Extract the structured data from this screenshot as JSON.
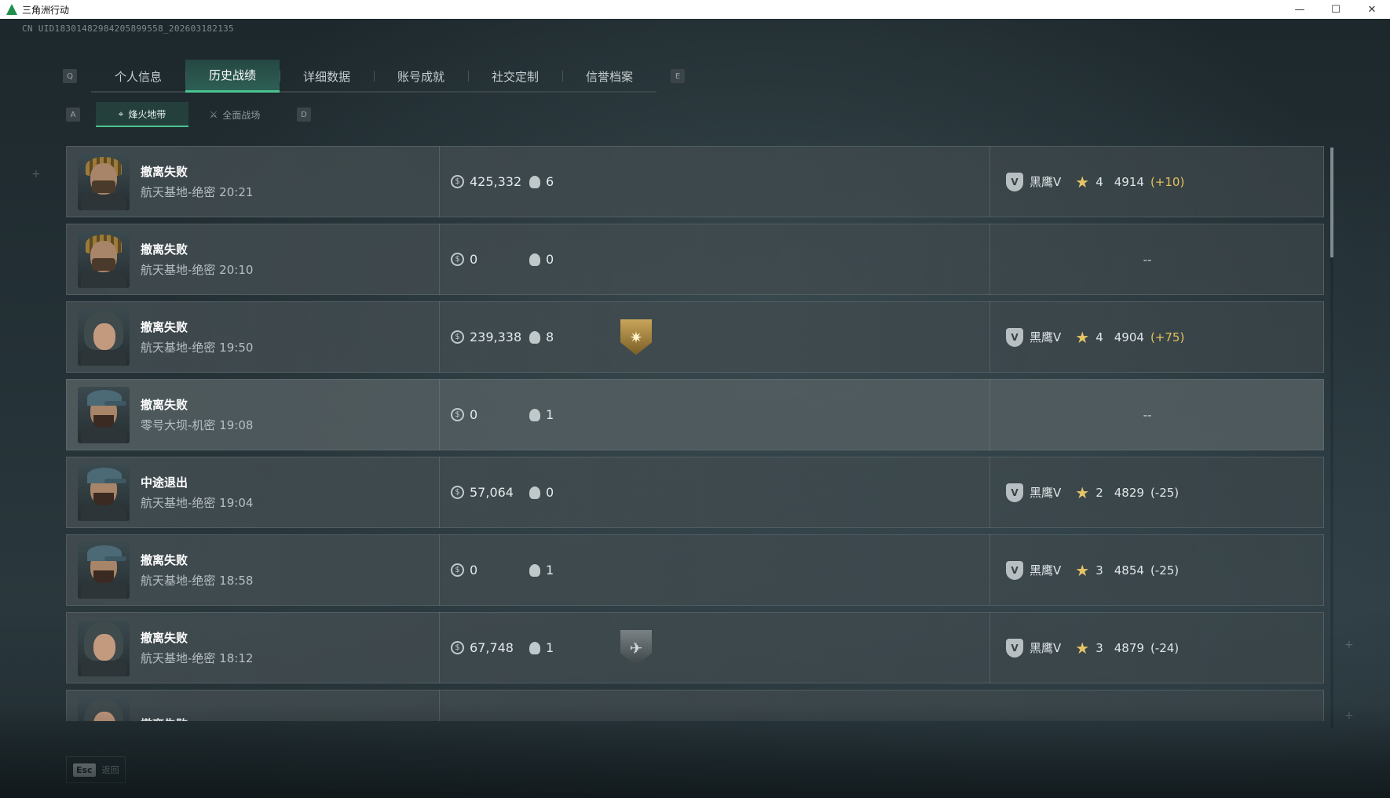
{
  "window": {
    "title": "三角洲行动",
    "minimize": "—",
    "maximize": "☐",
    "close": "✕"
  },
  "uid_text": "CN UID18301482984205899558_202603182135",
  "main_tabs": {
    "left_key": "Q",
    "right_key": "E",
    "items": [
      {
        "label": "个人信息",
        "active": false
      },
      {
        "label": "历史战绩",
        "active": true
      },
      {
        "label": "详细数据",
        "active": false
      },
      {
        "label": "账号成就",
        "active": false
      },
      {
        "label": "社交定制",
        "active": false
      },
      {
        "label": "信誉档案",
        "active": false
      }
    ]
  },
  "sub_tabs": {
    "left_key": "A",
    "right_key": "D",
    "items": [
      {
        "label": "烽火地带",
        "icon": "crosshair-icon",
        "active": true
      },
      {
        "label": "全面战场",
        "icon": "rifle-icon",
        "active": false
      }
    ]
  },
  "records": [
    {
      "avatar": "helmet",
      "result": "撤离失败",
      "map_time": "航天基地-绝密 20:21",
      "money": "425,332",
      "kills": "6",
      "badge": "",
      "rank_name": "黑鹰V",
      "stars": "4",
      "score": "4914",
      "delta": "(+10)",
      "delta_positive": true
    },
    {
      "avatar": "helmet",
      "result": "撤离失败",
      "map_time": "航天基地-绝密 20:10",
      "money": "0",
      "kills": "0",
      "badge": "",
      "rank_name": "",
      "stars": "",
      "score": "",
      "delta": "",
      "empty_rank": "--"
    },
    {
      "avatar": "hood",
      "result": "撤离失败",
      "map_time": "航天基地-绝密 19:50",
      "money": "239,338",
      "kills": "8",
      "badge": "gold",
      "rank_name": "黑鹰V",
      "stars": "4",
      "score": "4904",
      "delta": "(+75)",
      "delta_positive": true
    },
    {
      "avatar": "capguy",
      "result": "撤离失败",
      "map_time": "零号大坝-机密 19:08",
      "money": "0",
      "kills": "1",
      "badge": "",
      "rank_name": "",
      "stars": "",
      "score": "",
      "delta": "",
      "empty_rank": "--",
      "highlight": true
    },
    {
      "avatar": "capguy",
      "result": "中途退出",
      "map_time": "航天基地-绝密 19:04",
      "money": "57,064",
      "kills": "0",
      "badge": "",
      "rank_name": "黑鹰V",
      "stars": "2",
      "score": "4829",
      "delta": "(-25)",
      "delta_positive": false
    },
    {
      "avatar": "capguy",
      "result": "撤离失败",
      "map_time": "航天基地-绝密 18:58",
      "money": "0",
      "kills": "1",
      "badge": "",
      "rank_name": "黑鹰V",
      "stars": "3",
      "score": "4854",
      "delta": "(-25)",
      "delta_positive": false
    },
    {
      "avatar": "hood",
      "result": "撤离失败",
      "map_time": "航天基地-绝密 18:12",
      "money": "67,748",
      "kills": "1",
      "badge": "dark",
      "rank_name": "黑鹰V",
      "stars": "3",
      "score": "4879",
      "delta": "(-24)",
      "delta_positive": false
    },
    {
      "avatar": "hood",
      "result": "撤离失败",
      "map_time": "",
      "money": "",
      "kills": "",
      "badge": "",
      "rank_name": "",
      "stars": "",
      "score": "",
      "delta": "",
      "partial": true
    }
  ],
  "footer": {
    "esc_key": "Esc",
    "back_label": "返回"
  },
  "colors": {
    "accent": "#4cc38f",
    "gold": "#e3c15c"
  }
}
